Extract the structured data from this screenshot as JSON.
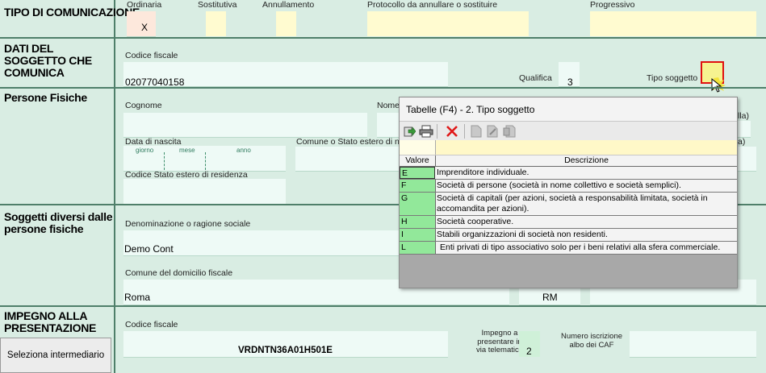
{
  "sections": {
    "comunicazione": "TIPO DI COMUNICAZIONE",
    "soggetto": "DATI DEL SOGGETTO CHE COMUNICA",
    "persone_fisiche": "Persone Fisiche",
    "soggetti_diversi": "Soggetti diversi dalle persone fisiche",
    "impegno": "IMPEGNO ALLA PRESENTAZIONE"
  },
  "comunicazione": {
    "ordinaria_label": "Ordinaria",
    "ordinaria_value": "X",
    "sostitutiva_label": "Sostitutiva",
    "annullamento_label": "Annullamento",
    "protocollo_label": "Protocollo da annullare o sostituire",
    "progressivo_label": "Progressivo"
  },
  "soggetto": {
    "codice_fiscale_label": "Codice fiscale",
    "codice_fiscale_value": "02077040158",
    "qualifica_label": "Qualifica",
    "qualifica_value": "3",
    "tipo_soggetto_label": "Tipo soggetto"
  },
  "persone": {
    "cognome_label": "Cognome",
    "nome_label": "Nome",
    "data_nascita_label": "Data di nascita",
    "giorno_label": "giorno",
    "mese_label": "mese",
    "anno_label": "anno",
    "comune_label": "Comune o Stato estero di na",
    "codice_stato_label": "Codice Stato estero di residenza",
    "sesso_fragment": "lla)",
    "prov_fragment": "a)"
  },
  "diversi": {
    "denominazione_label": "Denominazione o ragione sociale",
    "denominazione_value": "Demo Cont",
    "comune_domicilio_label": "Comune del domicilio fiscale",
    "comune_domicilio_value": "Roma",
    "provincia_value": "RM"
  },
  "impegno": {
    "codice_fiscale_label": "Codice fiscale",
    "codice_fiscale_value": "VRDNTN36A01H501E",
    "impegno_label_1": "Impegno a",
    "impegno_label_2": "presentare in",
    "impegno_label_3": "via telematica",
    "impegno_value": "2",
    "numero_label_1": "Numero iscrizione",
    "numero_label_2": "albo dei CAF",
    "seleziona_button": "Seleziona intermediario"
  },
  "popup": {
    "title": "Tabelle (F4) - 2. Tipo soggetto",
    "col_valore": "Valore",
    "col_descrizione": "Descrizione",
    "rows": [
      {
        "valore": "E",
        "descrizione": "Imprenditore individuale."
      },
      {
        "valore": "F",
        "descrizione": "Società di persone (società in nome collettivo e società semplici)."
      },
      {
        "valore": "G",
        "descrizione": "Società di capitali (per azioni, società a responsabilità limitata, società in accomandita per azioni)."
      },
      {
        "valore": "H",
        "descrizione": "Società cooperative."
      },
      {
        "valore": "I",
        "descrizione": "Stabili organizzazioni di società non residenti."
      },
      {
        "valore": "L",
        "descrizione": "Enti privati di tipo associativo solo per i beni relativi alla sfera commerciale."
      }
    ],
    "toolbar_icons": [
      "export-icon",
      "print-icon",
      "delete-icon",
      "document-icon",
      "document-edit-icon",
      "document-copy-icon"
    ]
  },
  "colors": {
    "form_background": "#d9ede3",
    "field_background": "#eefaf6",
    "selected_field": "#fffbd0",
    "value_column": "#92e89a",
    "highlight_border": "#e01010"
  }
}
